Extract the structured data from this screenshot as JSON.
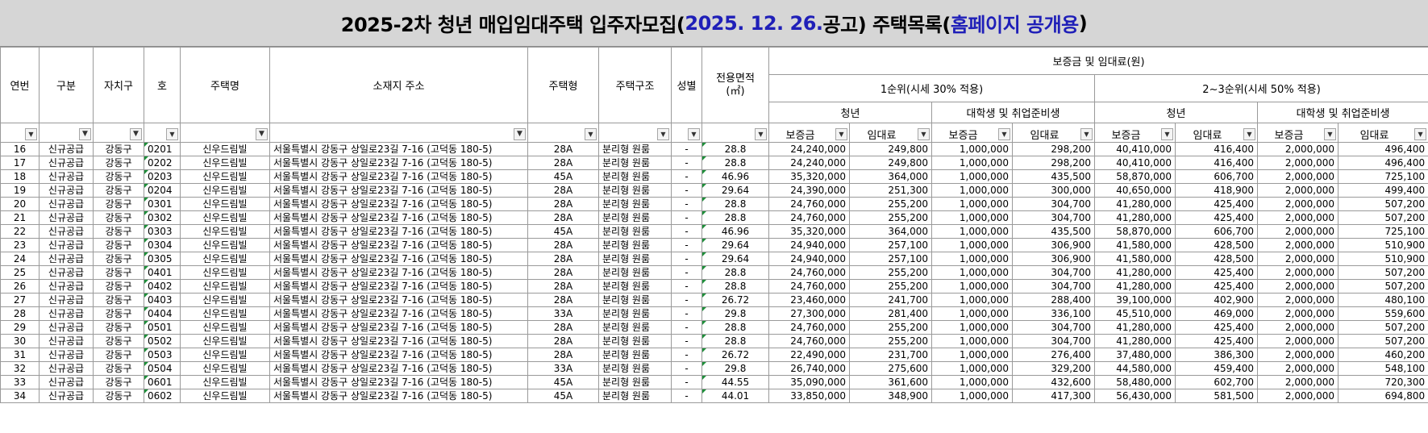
{
  "title": {
    "part1": "2025-2차 청년 매입임대주택 입주자모집(",
    "part2": "2025. 12. 26.",
    "part3": " 공고) 주택목록(",
    "part4": "홈페이지 공개용",
    "part5": ")"
  },
  "headers": {
    "seq": "연번",
    "category": "구분",
    "district": "자치구",
    "unit": "호",
    "house_name": "주택명",
    "address": "소재지 주소",
    "house_type": "주택형",
    "structure": "주택구조",
    "gender": "성별",
    "area": "전용면적\n(㎡)",
    "deposit_rent": "보증금 및 임대료(원)",
    "rank1": "1순위(시세 30% 적용)",
    "rank23": "2~3순위(시세 50% 적용)",
    "youth": "청년",
    "student": "대학생 및 취업준비생",
    "deposit": "보증금",
    "rent": "임대료"
  },
  "icons": {
    "filter": "dropdown-arrow-icon",
    "filter_active": "filter-applied-icon"
  },
  "rows": [
    [
      "16",
      "신규공급",
      "강동구",
      "0201",
      "신우드림빌",
      "서울특별시 강동구 상일로23길 7-16 (고덕동 180-5)",
      "28A",
      "분리형 원룸",
      "-",
      "28.8",
      "24,240,000",
      "249,800",
      "1,000,000",
      "298,200",
      "40,410,000",
      "416,400",
      "2,000,000",
      "496,400"
    ],
    [
      "17",
      "신규공급",
      "강동구",
      "0202",
      "신우드림빌",
      "서울특별시 강동구 상일로23길 7-16 (고덕동 180-5)",
      "28A",
      "분리형 원룸",
      "-",
      "28.8",
      "24,240,000",
      "249,800",
      "1,000,000",
      "298,200",
      "40,410,000",
      "416,400",
      "2,000,000",
      "496,400"
    ],
    [
      "18",
      "신규공급",
      "강동구",
      "0203",
      "신우드림빌",
      "서울특별시 강동구 상일로23길 7-16 (고덕동 180-5)",
      "45A",
      "분리형 원룸",
      "-",
      "46.96",
      "35,320,000",
      "364,000",
      "1,000,000",
      "435,500",
      "58,870,000",
      "606,700",
      "2,000,000",
      "725,100"
    ],
    [
      "19",
      "신규공급",
      "강동구",
      "0204",
      "신우드림빌",
      "서울특별시 강동구 상일로23길 7-16 (고덕동 180-5)",
      "28A",
      "분리형 원룸",
      "-",
      "29.64",
      "24,390,000",
      "251,300",
      "1,000,000",
      "300,000",
      "40,650,000",
      "418,900",
      "2,000,000",
      "499,400"
    ],
    [
      "20",
      "신규공급",
      "강동구",
      "0301",
      "신우드림빌",
      "서울특별시 강동구 상일로23길 7-16 (고덕동 180-5)",
      "28A",
      "분리형 원룸",
      "-",
      "28.8",
      "24,760,000",
      "255,200",
      "1,000,000",
      "304,700",
      "41,280,000",
      "425,400",
      "2,000,000",
      "507,200"
    ],
    [
      "21",
      "신규공급",
      "강동구",
      "0302",
      "신우드림빌",
      "서울특별시 강동구 상일로23길 7-16 (고덕동 180-5)",
      "28A",
      "분리형 원룸",
      "-",
      "28.8",
      "24,760,000",
      "255,200",
      "1,000,000",
      "304,700",
      "41,280,000",
      "425,400",
      "2,000,000",
      "507,200"
    ],
    [
      "22",
      "신규공급",
      "강동구",
      "0303",
      "신우드림빌",
      "서울특별시 강동구 상일로23길 7-16 (고덕동 180-5)",
      "45A",
      "분리형 원룸",
      "-",
      "46.96",
      "35,320,000",
      "364,000",
      "1,000,000",
      "435,500",
      "58,870,000",
      "606,700",
      "2,000,000",
      "725,100"
    ],
    [
      "23",
      "신규공급",
      "강동구",
      "0304",
      "신우드림빌",
      "서울특별시 강동구 상일로23길 7-16 (고덕동 180-5)",
      "28A",
      "분리형 원룸",
      "-",
      "29.64",
      "24,940,000",
      "257,100",
      "1,000,000",
      "306,900",
      "41,580,000",
      "428,500",
      "2,000,000",
      "510,900"
    ],
    [
      "24",
      "신규공급",
      "강동구",
      "0305",
      "신우드림빌",
      "서울특별시 강동구 상일로23길 7-16 (고덕동 180-5)",
      "28A",
      "분리형 원룸",
      "-",
      "29.64",
      "24,940,000",
      "257,100",
      "1,000,000",
      "306,900",
      "41,580,000",
      "428,500",
      "2,000,000",
      "510,900"
    ],
    [
      "25",
      "신규공급",
      "강동구",
      "0401",
      "신우드림빌",
      "서울특별시 강동구 상일로23길 7-16 (고덕동 180-5)",
      "28A",
      "분리형 원룸",
      "-",
      "28.8",
      "24,760,000",
      "255,200",
      "1,000,000",
      "304,700",
      "41,280,000",
      "425,400",
      "2,000,000",
      "507,200"
    ],
    [
      "26",
      "신규공급",
      "강동구",
      "0402",
      "신우드림빌",
      "서울특별시 강동구 상일로23길 7-16 (고덕동 180-5)",
      "28A",
      "분리형 원룸",
      "-",
      "28.8",
      "24,760,000",
      "255,200",
      "1,000,000",
      "304,700",
      "41,280,000",
      "425,400",
      "2,000,000",
      "507,200"
    ],
    [
      "27",
      "신규공급",
      "강동구",
      "0403",
      "신우드림빌",
      "서울특별시 강동구 상일로23길 7-16 (고덕동 180-5)",
      "28A",
      "분리형 원룸",
      "-",
      "26.72",
      "23,460,000",
      "241,700",
      "1,000,000",
      "288,400",
      "39,100,000",
      "402,900",
      "2,000,000",
      "480,100"
    ],
    [
      "28",
      "신규공급",
      "강동구",
      "0404",
      "신우드림빌",
      "서울특별시 강동구 상일로23길 7-16 (고덕동 180-5)",
      "33A",
      "분리형 원룸",
      "-",
      "29.8",
      "27,300,000",
      "281,400",
      "1,000,000",
      "336,100",
      "45,510,000",
      "469,000",
      "2,000,000",
      "559,600"
    ],
    [
      "29",
      "신규공급",
      "강동구",
      "0501",
      "신우드림빌",
      "서울특별시 강동구 상일로23길 7-16 (고덕동 180-5)",
      "28A",
      "분리형 원룸",
      "-",
      "28.8",
      "24,760,000",
      "255,200",
      "1,000,000",
      "304,700",
      "41,280,000",
      "425,400",
      "2,000,000",
      "507,200"
    ],
    [
      "30",
      "신규공급",
      "강동구",
      "0502",
      "신우드림빌",
      "서울특별시 강동구 상일로23길 7-16 (고덕동 180-5)",
      "28A",
      "분리형 원룸",
      "-",
      "28.8",
      "24,760,000",
      "255,200",
      "1,000,000",
      "304,700",
      "41,280,000",
      "425,400",
      "2,000,000",
      "507,200"
    ],
    [
      "31",
      "신규공급",
      "강동구",
      "0503",
      "신우드림빌",
      "서울특별시 강동구 상일로23길 7-16 (고덕동 180-5)",
      "28A",
      "분리형 원룸",
      "-",
      "26.72",
      "22,490,000",
      "231,700",
      "1,000,000",
      "276,400",
      "37,480,000",
      "386,300",
      "2,000,000",
      "460,200"
    ],
    [
      "32",
      "신규공급",
      "강동구",
      "0504",
      "신우드림빌",
      "서울특별시 강동구 상일로23길 7-16 (고덕동 180-5)",
      "33A",
      "분리형 원룸",
      "-",
      "29.8",
      "26,740,000",
      "275,600",
      "1,000,000",
      "329,200",
      "44,580,000",
      "459,400",
      "2,000,000",
      "548,100"
    ],
    [
      "33",
      "신규공급",
      "강동구",
      "0601",
      "신우드림빌",
      "서울특별시 강동구 상일로23길 7-16 (고덕동 180-5)",
      "45A",
      "분리형 원룸",
      "-",
      "44.55",
      "35,090,000",
      "361,600",
      "1,000,000",
      "432,600",
      "58,480,000",
      "602,700",
      "2,000,000",
      "720,300"
    ],
    [
      "34",
      "신규공급",
      "강동구",
      "0602",
      "신우드림빌",
      "서울특별시 강동구 상일로23길 7-16 (고덕동 180-5)",
      "45A",
      "분리형 원룸",
      "-",
      "44.01",
      "33,850,000",
      "348,900",
      "1,000,000",
      "417,300",
      "56,430,000",
      "581,500",
      "2,000,000",
      "694,800"
    ]
  ]
}
